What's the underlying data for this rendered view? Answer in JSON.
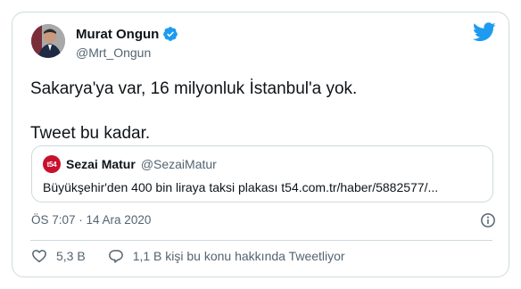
{
  "author": {
    "display_name": "Murat Ongun",
    "handle": "@Mrt_Ongun",
    "verified": true
  },
  "tweet": {
    "line1": "Sakarya'ya var, 16 milyonluk İstanbul'a yok.",
    "line2": "Tweet bu kadar."
  },
  "quote": {
    "avatar_text": "t54",
    "display_name": "Sezai Matur",
    "handle": "@SezaiMatur",
    "text": "Büyükşehir'den 400 bin liraya taksi plakası t54.com.tr/haber/5882577/..."
  },
  "timestamp": "ÖS 7:07 · 14 Ara 2020",
  "actions": {
    "likes": "5,3 B",
    "replies_label": "1,1 B kişi bu konu hakkında Tweetliyor"
  },
  "colors": {
    "brand_blue": "#1d9bf0",
    "text_primary": "#0f1419",
    "text_secondary": "#536471",
    "border": "#cfd9de",
    "quote_badge": "#c8102e"
  },
  "icons": [
    "verified-badge-icon",
    "twitter-bird-icon",
    "info-icon",
    "heart-icon",
    "reply-bubble-icon"
  ]
}
